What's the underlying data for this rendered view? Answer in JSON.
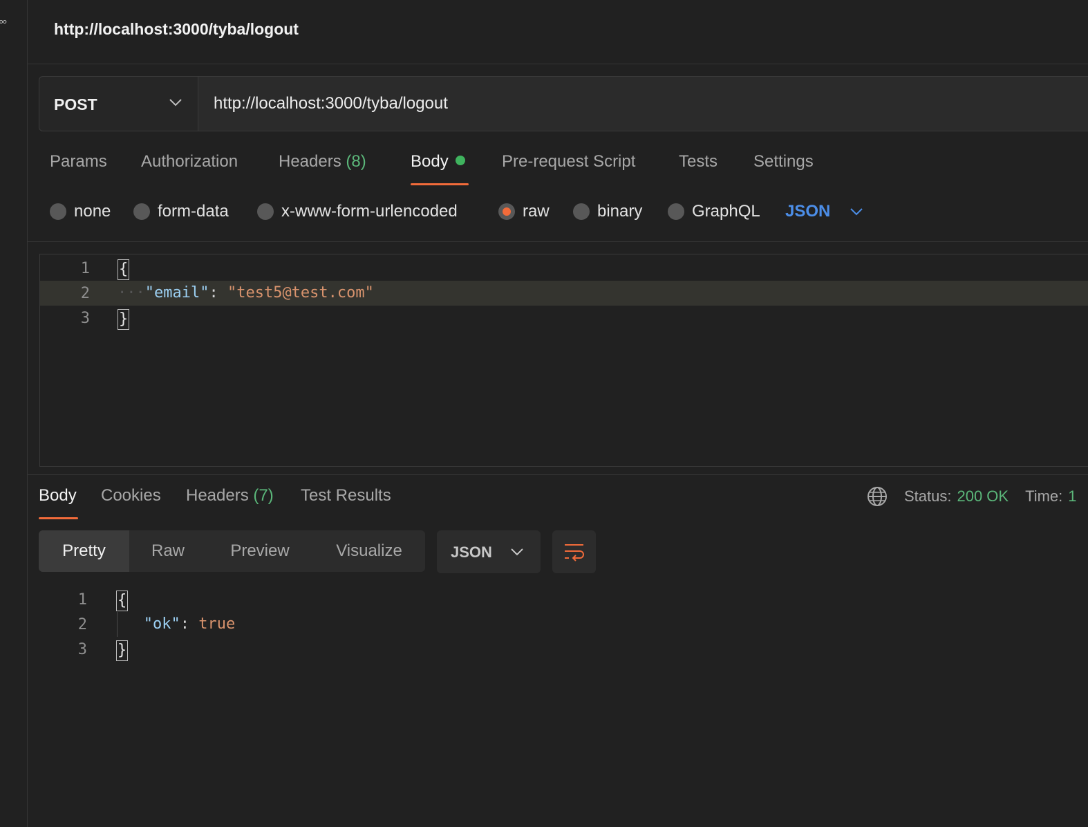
{
  "tab": {
    "title": "http://localhost:3000/tyba/logout"
  },
  "request": {
    "method": "POST",
    "url": "http://localhost:3000/tyba/logout"
  },
  "request_tabs": [
    {
      "label": "Params",
      "count": ""
    },
    {
      "label": "Authorization",
      "count": ""
    },
    {
      "label": "Headers",
      "count": "(8)"
    },
    {
      "label": "Body",
      "count": "",
      "active": true,
      "indicator": "green-dot"
    },
    {
      "label": "Pre-request Script",
      "count": ""
    },
    {
      "label": "Tests",
      "count": ""
    },
    {
      "label": "Settings",
      "count": ""
    }
  ],
  "body_types": [
    {
      "label": "none",
      "checked": false
    },
    {
      "label": "form-data",
      "checked": false
    },
    {
      "label": "x-www-form-urlencoded",
      "checked": false
    },
    {
      "label": "raw",
      "checked": true
    },
    {
      "label": "binary",
      "checked": false
    },
    {
      "label": "GraphQL",
      "checked": false
    }
  ],
  "body_language": "JSON",
  "request_body": {
    "lines": [
      {
        "num": "1",
        "open": "{"
      },
      {
        "num": "2",
        "key": "\"email\"",
        "sep": ": ",
        "value": "\"test5@test.com\""
      },
      {
        "num": "3",
        "close": "}"
      }
    ]
  },
  "response_tabs": [
    {
      "label": "Body",
      "count": "",
      "active": true
    },
    {
      "label": "Cookies",
      "count": ""
    },
    {
      "label": "Headers",
      "count": "(7)"
    },
    {
      "label": "Test Results",
      "count": ""
    }
  ],
  "response_status": {
    "status_label": "Status:",
    "status_value": "200 OK",
    "time_label": "Time:",
    "time_value": "1"
  },
  "response_views": [
    "Pretty",
    "Raw",
    "Preview",
    "Visualize"
  ],
  "response_format": "JSON",
  "response_body": {
    "lines": [
      {
        "num": "1",
        "open": "{"
      },
      {
        "num": "2",
        "key": "\"ok\"",
        "sep": ": ",
        "value": "true"
      },
      {
        "num": "3",
        "close": "}"
      }
    ]
  },
  "colors": {
    "accent": "#f26b3a",
    "success": "#5bb77a",
    "link": "#4c8ee8",
    "background": "#212121"
  },
  "icons": [
    "globe-icon",
    "chevron-down-icon",
    "wrap-lines-icon"
  ]
}
